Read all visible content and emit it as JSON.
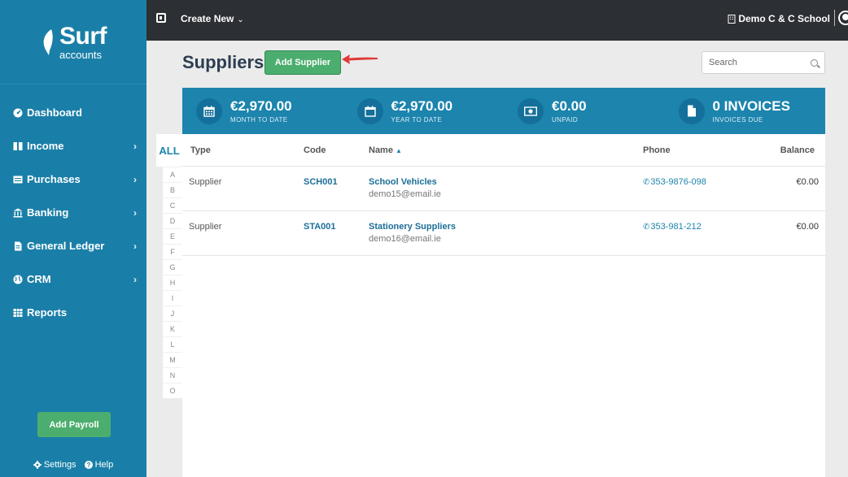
{
  "sidebar": {
    "logo_brand": "Surf",
    "logo_sub": "accounts",
    "items": [
      {
        "label": "Dashboard",
        "icon": "tachometer-icon",
        "has_chevron": false
      },
      {
        "label": "Income",
        "icon": "bank-note-icon",
        "has_chevron": true
      },
      {
        "label": "Purchases",
        "icon": "list-icon",
        "has_chevron": true
      },
      {
        "label": "Banking",
        "icon": "bank-icon",
        "has_chevron": true
      },
      {
        "label": "General Ledger",
        "icon": "document-icon",
        "has_chevron": true
      },
      {
        "label": "CRM",
        "icon": "globe-icon",
        "has_chevron": true
      },
      {
        "label": "Reports",
        "icon": "table-icon",
        "has_chevron": false
      }
    ],
    "payroll_button": "Add Payroll",
    "settings_label": "Settings",
    "help_label": "Help"
  },
  "topbar": {
    "create_new": "Create New",
    "organization": "Demo C & C School"
  },
  "page": {
    "title": "Suppliers",
    "add_button": "Add Supplier",
    "search_placeholder": "Search"
  },
  "stats": [
    {
      "value": "€2,970.00",
      "label": "MONTH TO DATE",
      "icon": "calendar-icon"
    },
    {
      "value": "€2,970.00",
      "label": "YEAR TO DATE",
      "icon": "calendar-year-icon"
    },
    {
      "value": "€0.00",
      "label": "UNPAID",
      "icon": "money-icon"
    },
    {
      "value": "0 INVOICES",
      "label": "INVOICES DUE",
      "icon": "file-icon"
    }
  ],
  "alphabet": {
    "all": "ALL",
    "letters": [
      "A",
      "B",
      "C",
      "D",
      "E",
      "F",
      "G",
      "H",
      "I",
      "J",
      "K",
      "L",
      "M",
      "N",
      "O"
    ]
  },
  "table": {
    "headers": {
      "type": "Type",
      "code": "Code",
      "name": "Name",
      "phone": "Phone",
      "balance": "Balance"
    },
    "rows": [
      {
        "type": "Supplier",
        "code": "SCH001",
        "name": "School Vehicles",
        "email": "demo15@email.ie",
        "phone": "353-9876-098",
        "balance": "€0.00"
      },
      {
        "type": "Supplier",
        "code": "STA001",
        "name": "Stationery Suppliers",
        "email": "demo16@email.ie",
        "phone": "353-981-212",
        "balance": "€0.00"
      }
    ]
  },
  "colors": {
    "sidebar": "#1a7fa8",
    "topbar": "#2c2f33",
    "accent_green": "#4cae6e",
    "stats_bar": "#1c84ad",
    "arrow": "#e03a3a"
  }
}
